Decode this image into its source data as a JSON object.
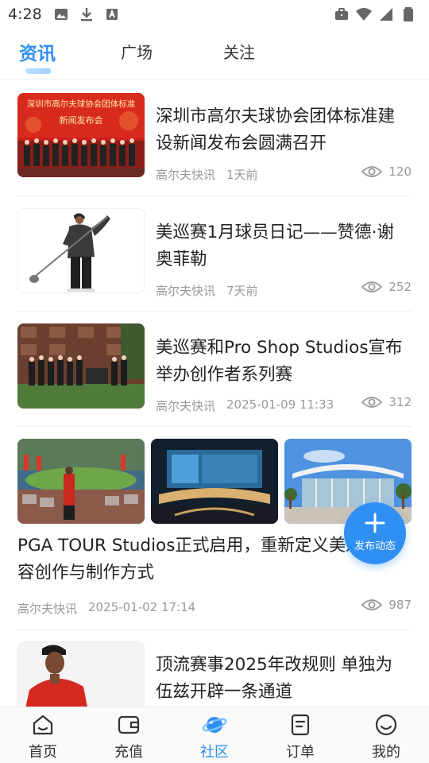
{
  "status_bar": {
    "time": "4:28"
  },
  "tabs": [
    {
      "label": "资讯",
      "active": true
    },
    {
      "label": "广场",
      "active": false
    },
    {
      "label": "关注",
      "active": false
    }
  ],
  "articles": [
    {
      "title_line1": "深圳市高尔夫球协会团体标准建",
      "title_line2": "设新闻发布会圆满召开",
      "source": "高尔夫快讯",
      "time": "1天前",
      "views": "120",
      "banner_line1": "深圳市高尔夫球协会团体标准",
      "banner_line2": "新闻发布会"
    },
    {
      "title_line1": "美巡赛1月球员日记——赞德·谢",
      "title_line2": "奥菲勒",
      "source": "高尔夫快讯",
      "time": "7天前",
      "views": "252"
    },
    {
      "title_line1": "美巡赛和Pro Shop Studios宣布",
      "title_line2": "举办创作者系列赛",
      "source": "高尔夫快讯",
      "time": "2025-01-09 11:33",
      "views": "312"
    },
    {
      "title_line1": "PGA TOUR Studios正式启用，重新定义美巡赛内",
      "title_line2": "容创作与制作方式",
      "source": "高尔夫快讯",
      "time": "2025-01-02 17:14",
      "views": "987"
    },
    {
      "title_line1": "顶流赛事2025年改规则 单独为",
      "title_line2": "伍兹开辟一条通道"
    }
  ],
  "fab": {
    "label": "发布动态",
    "icon": "plus-icon"
  },
  "bottom_nav": [
    {
      "label": "首页",
      "icon": "home-icon",
      "active": false
    },
    {
      "label": "充值",
      "icon": "wallet-icon",
      "active": false
    },
    {
      "label": "社区",
      "icon": "planet-icon",
      "active": true
    },
    {
      "label": "订单",
      "icon": "order-icon",
      "active": false
    },
    {
      "label": "我的",
      "icon": "profile-icon",
      "active": false
    }
  ],
  "colors": {
    "accent": "#2f8ff2",
    "meta_text": "#999999",
    "title_text": "#222222"
  }
}
